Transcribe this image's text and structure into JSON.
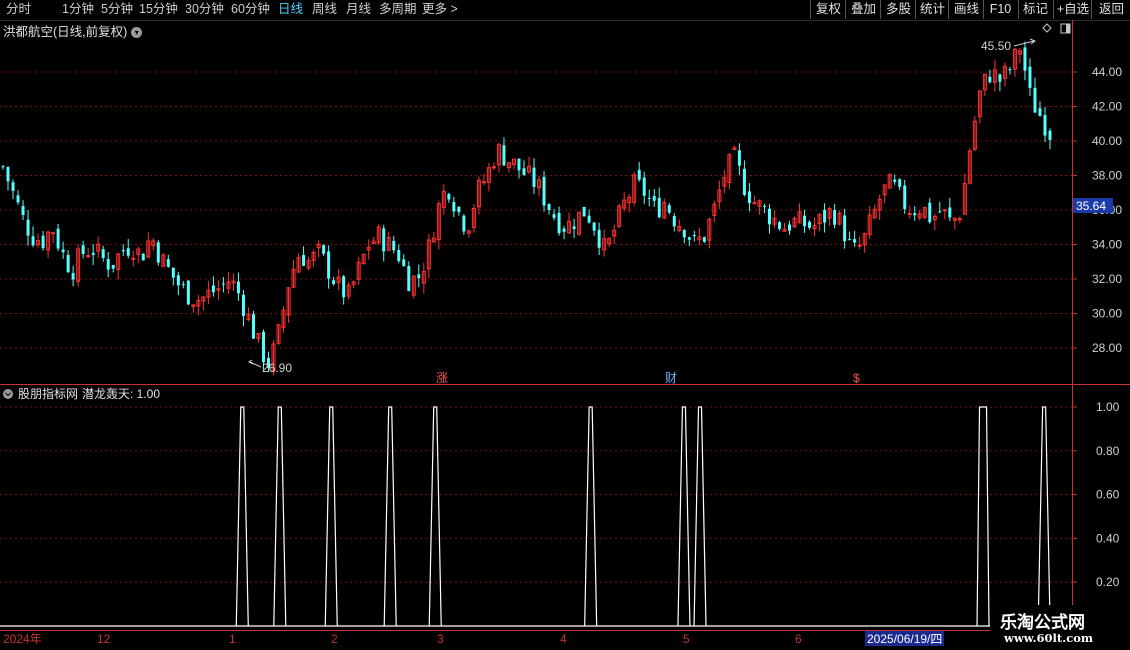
{
  "toolbar": {
    "periods": [
      "分时",
      "1分钟",
      "5分钟",
      "15分钟",
      "30分钟",
      "60分钟",
      "日线",
      "周线",
      "月线",
      "多周期",
      "更多 >"
    ],
    "active_period": "日线",
    "right_buttons": [
      "复权",
      "叠加",
      "多股",
      "统计",
      "画线",
      "F10",
      "+自选",
      "返回"
    ],
    "mark_button": "标记"
  },
  "main_panel": {
    "title": "洪都航空(日线,前复权)",
    "high_label": "45.50",
    "low_label": "26.90",
    "current_price": "35.64",
    "markers": [
      "涨",
      "财",
      "$"
    ],
    "colors": {
      "up": "#ff3232",
      "down": "#54ffff",
      "grid": "#7a1010",
      "axis": "#c83232"
    }
  },
  "indicator_panel": {
    "source_label": "股朋指标网",
    "indicator_name": "潜龙轰天: 1.00"
  },
  "time_axis": {
    "labels": [
      "2024年",
      "12",
      "1",
      "2",
      "3",
      "4",
      "5",
      "6"
    ],
    "cursor_date": "2025/06/19/四"
  },
  "watermark": {
    "line1": "乐淘公式网",
    "line2": "www.60lt.com"
  },
  "chart_data": [
    {
      "type": "candlestick",
      "title": "洪都航空(日线,前复权)",
      "y_ticks": [
        28,
        30,
        32,
        34,
        36,
        38,
        40,
        42,
        44
      ],
      "ylim": [
        26.9,
        45.5
      ],
      "series": [
        {
          "name": "close_path",
          "values": [
            38.5,
            37.0,
            35.5,
            34.5,
            34.2,
            35.0,
            33.5,
            32.5,
            33.5,
            33.8,
            33.2,
            32.8,
            33.6,
            34.0,
            33.3,
            34.5,
            33.2,
            32.3,
            31.5,
            31.0,
            30.8,
            31.2,
            31.5,
            32.0,
            31.0,
            29.5,
            28.0,
            27.0,
            29.0,
            32.0,
            33.5,
            33.0,
            33.5,
            32.5,
            31.5,
            31.0,
            32.5,
            34.0,
            34.5,
            34.0,
            33.5,
            32.0,
            32.0,
            33.5,
            36.0,
            37.5,
            36.0,
            35.0,
            37.0,
            38.0,
            39.5,
            39.0,
            38.5,
            38.0,
            37.5,
            36.5,
            35.5,
            35.0,
            35.5,
            36.0,
            35.0,
            33.5,
            35.0,
            36.5,
            37.5,
            37.0,
            36.0,
            36.5,
            35.5,
            35.0,
            34.0,
            34.5,
            36.0,
            38.0,
            39.0,
            37.5,
            36.5,
            36.0,
            35.5,
            35.0,
            35.3,
            35.2,
            35.0,
            35.5,
            36.0,
            35.0,
            33.5,
            34.0,
            35.5,
            37.0,
            37.5,
            36.5,
            36.0,
            36.2,
            35.5,
            36.0,
            35.2,
            36.0,
            40.0,
            43.0,
            44.0,
            43.5,
            44.2,
            45.5,
            42.5,
            41.5,
            40.5
          ]
        }
      ]
    },
    {
      "type": "line",
      "title": "潜龙轰天",
      "y_ticks": [
        0.2,
        0.4,
        0.6,
        0.8,
        1.0
      ],
      "ylim": [
        0,
        1
      ],
      "spike_positions_pct": [
        22.6,
        26.1,
        30.9,
        36.4,
        40.6,
        55.1,
        63.8,
        65.3,
        91.7,
        97.4
      ],
      "spike_value": 1.0,
      "last_value": 1.0
    }
  ]
}
